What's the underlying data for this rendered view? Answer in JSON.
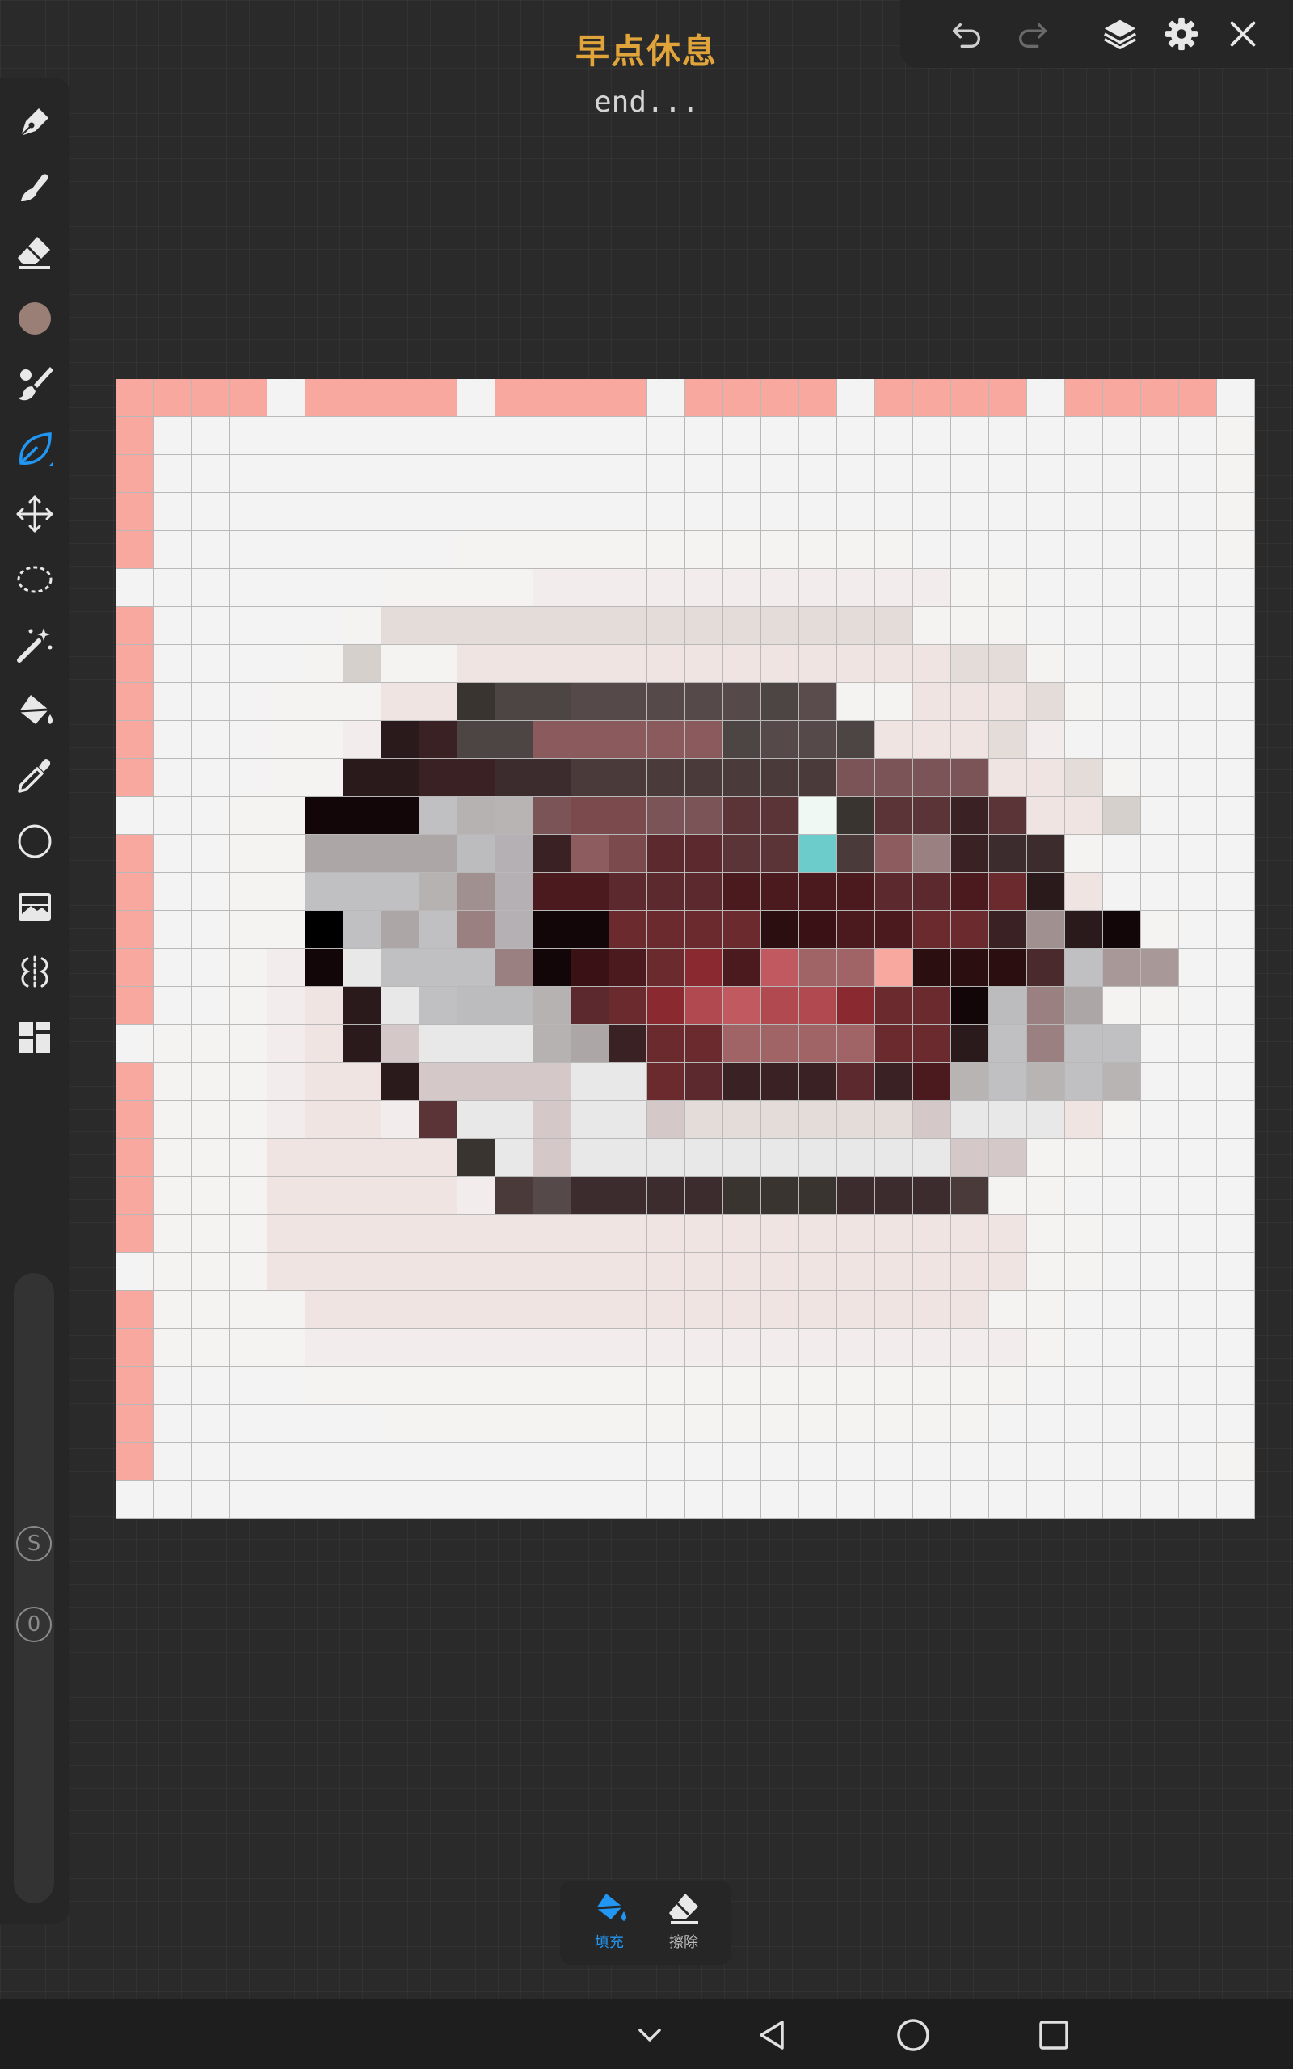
{
  "header": {
    "title": "早点休息",
    "subtitle": "end..."
  },
  "topbar": {
    "icons": [
      "undo-icon",
      "redo-icon",
      "layers-icon",
      "gear-icon",
      "close-icon"
    ]
  },
  "tools": [
    "pen-icon",
    "smudge-icon",
    "eraser-icon",
    "color-swatch",
    "brush-icon",
    "leaf-icon",
    "move-icon",
    "lasso-icon",
    "magic-wand-icon",
    "fill-bucket-icon",
    "eyedropper-icon",
    "circle-icon",
    "image-icon",
    "symmetry-icon",
    "grid-layout-icon"
  ],
  "colors": {
    "accent": "#2196f3",
    "title": "#e0a43a",
    "current_color": "#9a7f76",
    "marker": "#f8a89e",
    "blank": "#f3f3f3"
  },
  "slider": {
    "size_label": "S",
    "opacity_label": "0"
  },
  "bottom_toolbar": {
    "fill_label": "填充",
    "erase_label": "擦除"
  },
  "navbar": {
    "icons": [
      "chevron-down-icon",
      "back-icon",
      "home-icon",
      "recents-icon"
    ]
  },
  "canvas": {
    "grid_size": 30,
    "palette": {
      "a": "#f3f3f3",
      "A": "#f5f2f2",
      "B": "#f3ecec",
      "E": "#f0e4e2",
      "D": "#e3dcd9",
      "d": "#d6d0cd",
      "P": "#f8a89e",
      "G": "#3a3430",
      "K": "#4d4543",
      "k": "#55494a",
      "L": "#5a4c4c",
      "R": "#8a5a5c",
      "r": "#7a5456",
      "V": "#2a1a1c",
      "v": "#1e1012",
      "w": "#5a3436",
      "W": "#7a4a4c",
      "X": "#4a2a2c",
      "x": "#3a2224",
      "m": "#5c2a2e",
      "M": "#6a2a2e",
      "n": "#4a1a1e",
      "N": "#3a1216",
      "o": "#2a0e10",
      "O": "#120608",
      "Z": "#000000",
      "g": "#c0c0c2",
      "H": "#b8b4b4",
      "h": "#bcbcbe",
      "I": "#ada6a6",
      "i": "#a09090",
      "J": "#c8c0c0",
      "j": "#e8e8e8",
      "Q": "#a8a0a8",
      "q": "#b4b0b4",
      "U": "#d4c8c8",
      "u": "#dcd4d4",
      "T": "#c0b4b4",
      "t": "#b0a8a8",
      "s": "#9a8080",
      "F": "#f0f8f4",
      "C": "#6ccccc",
      "y": "#8c5c5e",
      "Y": "#b04a50",
      "z": "#c05a60",
      "e": "#a06466",
      "f": "#7a1a20",
      "l": "#8a2a30",
      "p": "#b7b2b2",
      "b": "#3c2c2e",
      "c": "#4a3a3a",
      "S": "#a89898"
    },
    "rows": [
      "PPPPaPPPPaPPPPaPPPPaPPPPaPPPPa",
      "PaaaaaaaaaaaaaaaaaaaaaaaaaaaaA",
      "PaaaaaaaaaaaaaaaaaaaaaaaaaaaaA",
      "PaaaaaaaaaaaaaaaaaaaaaaaaaaaaA",
      "PaaaaaaaaAAAAAAAAAAAAaaaaaaaaA",
      "aaaaaaaAAAABBBBBBBBBBBAAaaaaaa",
      "PaaaaaADDDDDDDDDDDDDDAAAaaaaaa",
      "PaaaaAdAAEEEEEEEEEEEEEDDAaaaaa",
      "PaaaAAAEEGKKkkkkkKLAAEEEDAaaaa",
      "PaaaAABVxKKRRRRRKkkKEEEDBaaaaa",
      "PaaaAAVVxxbbcccccccrrrrEEDAaaa",
      "aaaAAOOOgpHrWWrrwwFGwwxwEEdaaa",
      "PaaAAIIIIhqxyWmmwwCcysxbbAaaaa",
      "PaaAAgggpiqnnmmmnnnnmmnMVEaaaa",
      "PaaAAZgIgsqOOMMMMoNnnMMxiVOAaa",
      "PaaABOjgggsONnMlnzeePoooXgSSaa",
      "PaaABEVjghhpmMlYzYYlMMOhsIAAaa",
      "aAAABEVUjjjpIxMMeeeeMMVgsggaaa",
      "PAAABEEVUUUUjjMmxxxmxnHgHgHaaa",
      "PAAABEEBwjjUjjUDDDDDDUjjjEAaaa",
      "PAAAEEEEEGjUjjjjjjjjjjUUAAaaaa",
      "PAAAEEEEEBckbbbbGGGbbbcAAaaaaa",
      "PAAAEEEEEEEEEEEEEEEEEEEEAAaaaa",
      "aAAAEEEEEEEEEEEEEEEEEEEEAAaaaa",
      "PAAAAEEEEEEEEEEEEEEEEEEAAaaaaa",
      "PAAAABBBBBBBBBBBBBBBBBBBAaaaaa",
      "PaaaaAAAAAAAAAAAAAAAAAAAaaaaaa",
      "PaaaaaaAAAAAAAAAAAAAAAAaaaaaaa",
      "PaaaaaaaaaaaaaaaaaaaaaaaaaaaaA",
      "aaaaaaaaaaaaaaaaaaaaaaaaaaaaaa"
    ]
  }
}
